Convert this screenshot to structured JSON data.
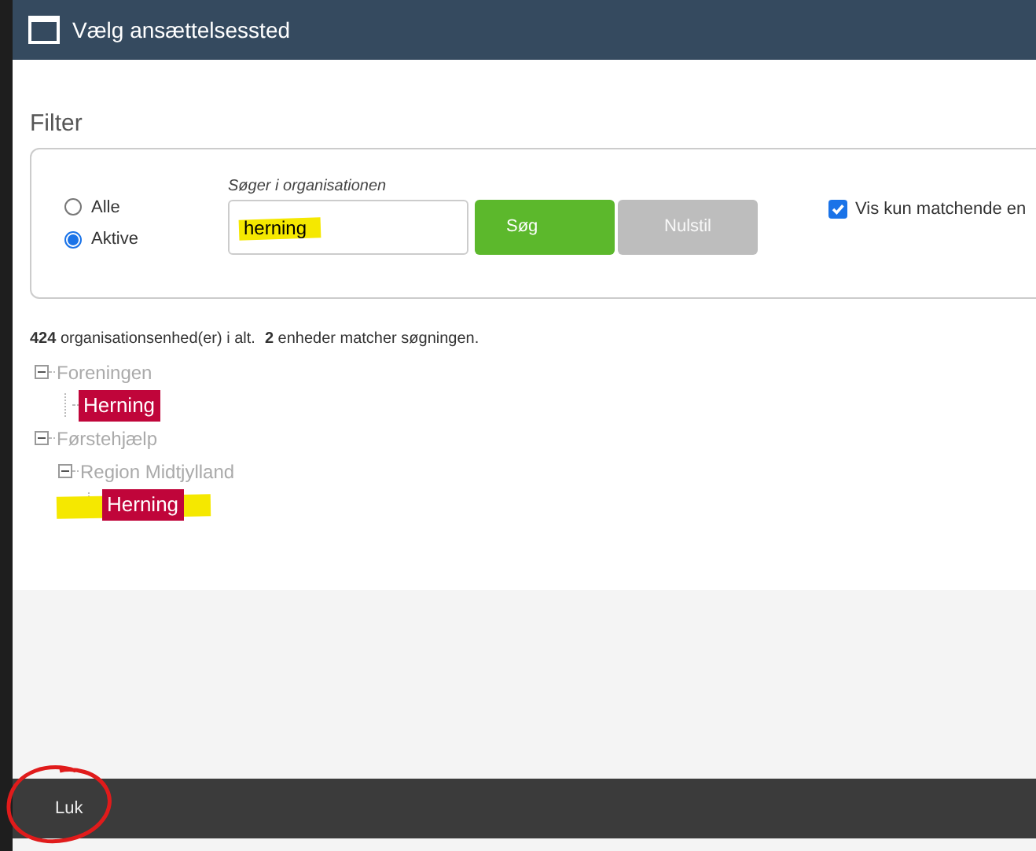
{
  "window": {
    "title": "Vælg ansættelsessted"
  },
  "filter": {
    "heading": "Filter",
    "status_options": [
      {
        "label": "Alle",
        "selected": false
      },
      {
        "label": "Aktive",
        "selected": true
      }
    ],
    "search": {
      "label": "Søger i organisationen",
      "value": "herning"
    },
    "buttons": [
      {
        "label": "Søg",
        "kind": "primary"
      },
      {
        "label": "Nulstil",
        "kind": "secondary"
      }
    ],
    "only_matching": {
      "label": "Vis kun matchende en",
      "checked": true
    }
  },
  "summary": [
    {
      "count": "424",
      "text": "organisationsenhed(er) i alt."
    },
    {
      "count": "2",
      "text": "enheder matcher søgningen."
    }
  ],
  "tree": [
    {
      "label": "Foreningen",
      "matched": false,
      "expanded": true,
      "children": [
        {
          "label": "Herning",
          "matched": true
        }
      ]
    },
    {
      "label": "Førstehjælp",
      "matched": false,
      "expanded": true,
      "children": [
        {
          "label": "Region Midtjylland",
          "matched": false,
          "expanded": true,
          "children": [
            {
              "label": "Herning",
              "matched": true
            }
          ]
        }
      ]
    }
  ],
  "footer": {
    "button": "Luk"
  }
}
